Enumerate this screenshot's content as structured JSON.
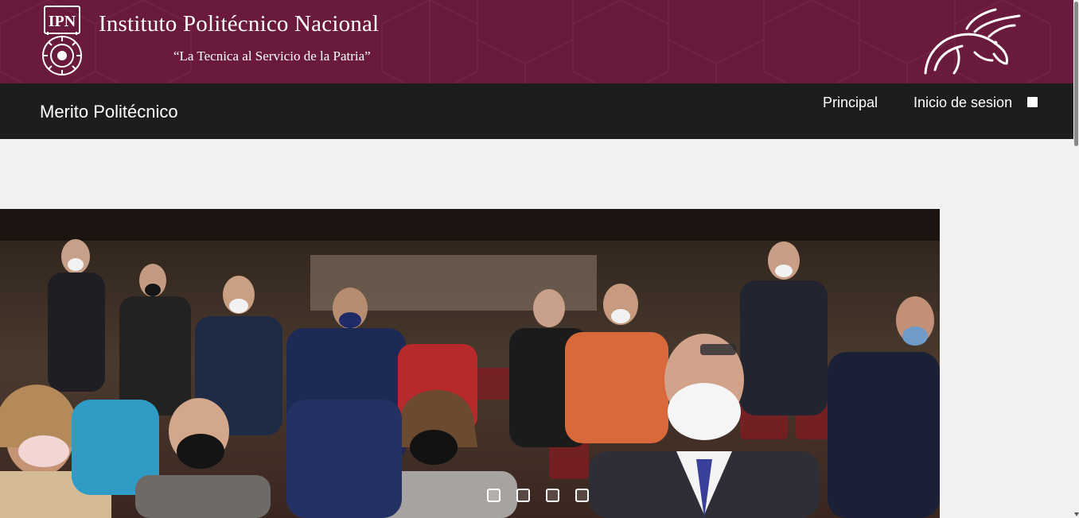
{
  "banner": {
    "institution_name": "Instituto Politécnico Nacional",
    "motto": "“La Tecnica al Servicio de la Patria”",
    "seal_text": "IPN",
    "seal_icon": "ipn-seal-icon",
    "mascot_icon": "burro-blanco-logo-icon",
    "background_color": "#6a1b3d"
  },
  "navbar": {
    "brand": "Merito Politécnico",
    "links": [
      {
        "label": "Principal"
      },
      {
        "label": "Inicio de sesion"
      }
    ],
    "toggle_checked": false,
    "background_color": "#1d1d1d"
  },
  "carousel": {
    "slide_count": 4,
    "active_index": 0,
    "slide_description_icon": "audience-applauding-photo"
  }
}
